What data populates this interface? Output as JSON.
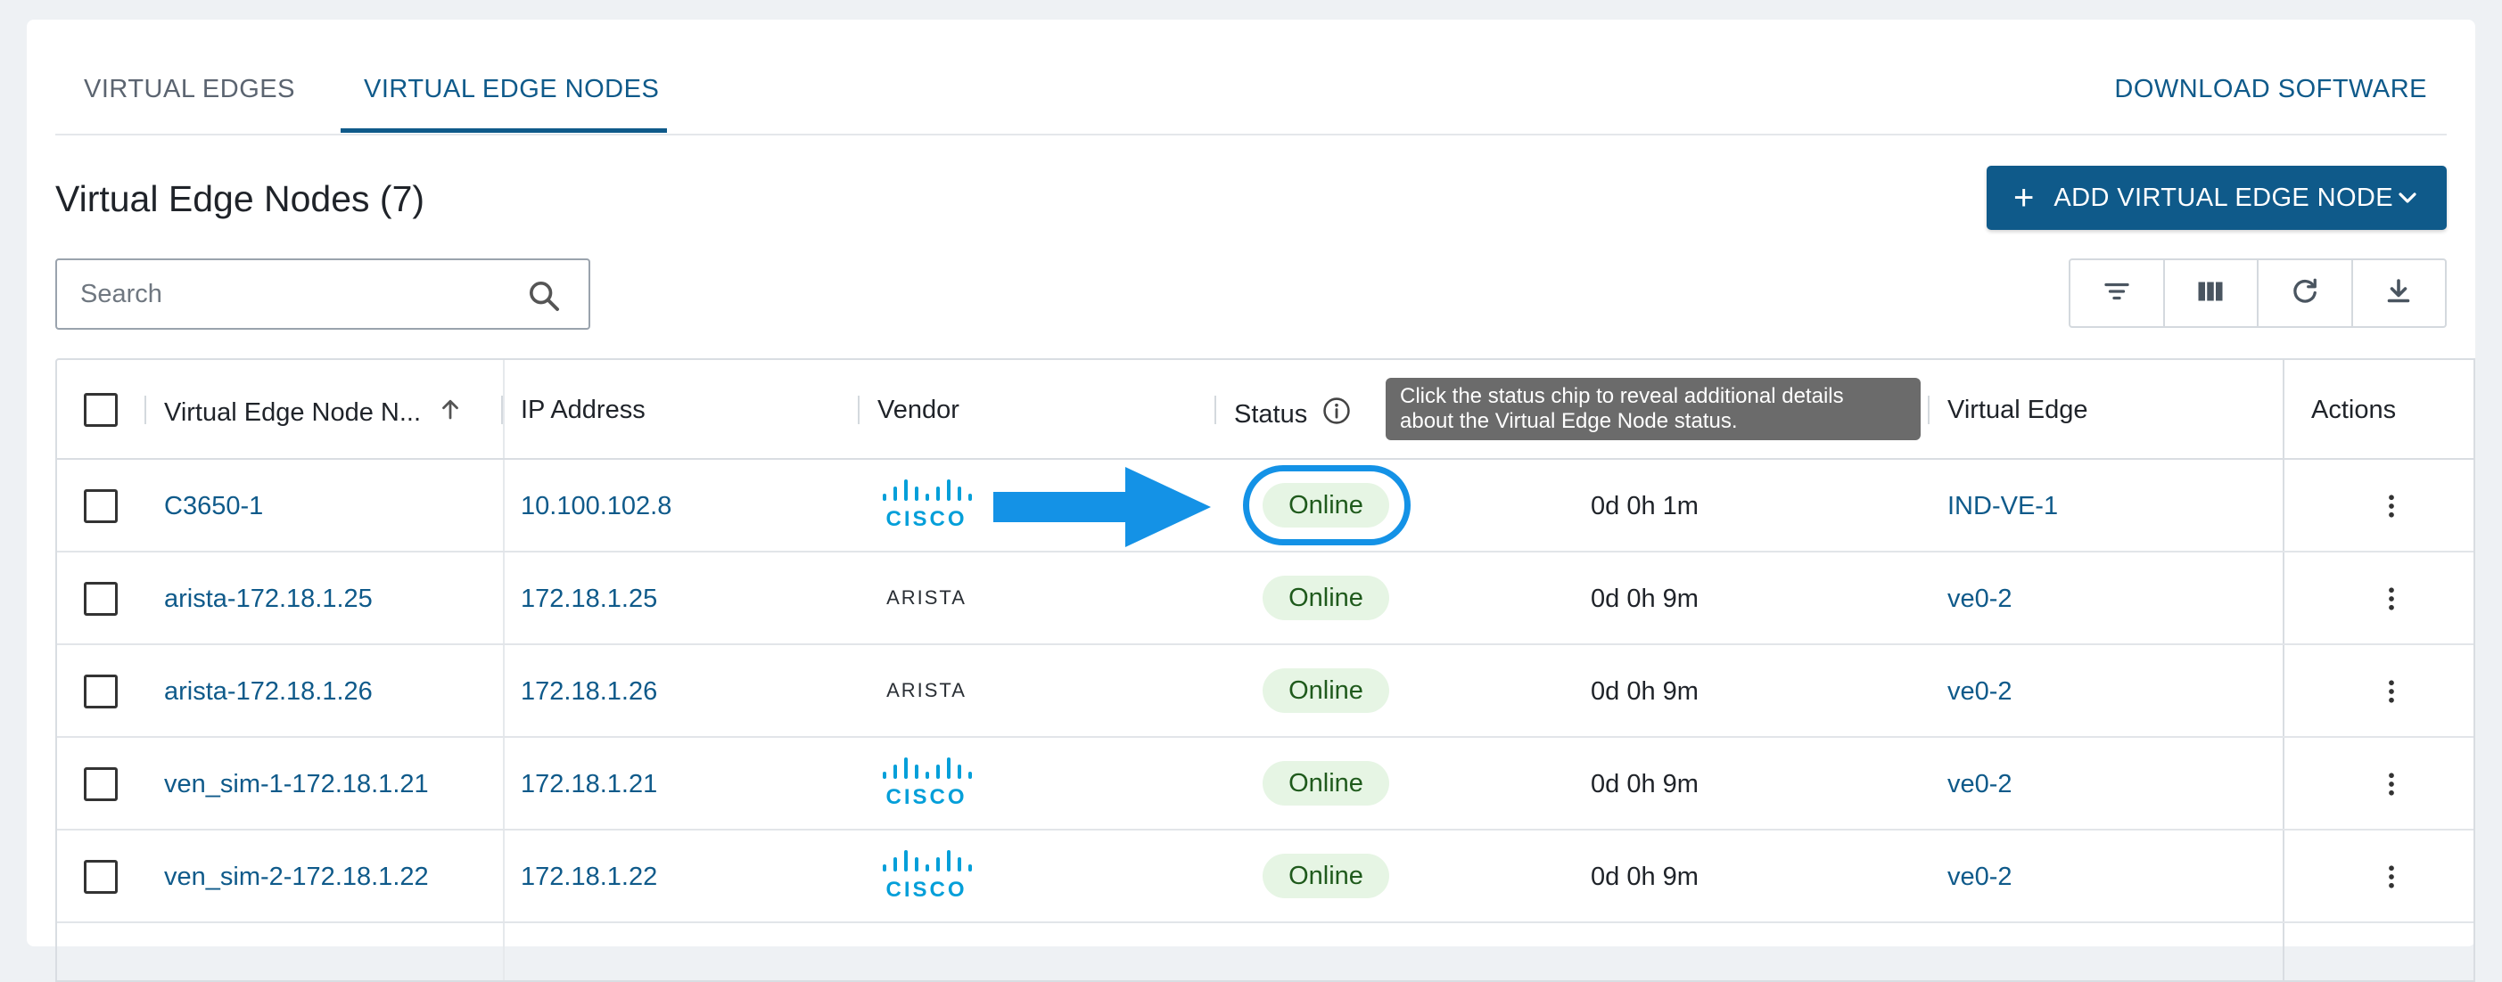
{
  "tabs": {
    "virtual_edges": "VIRTUAL EDGES",
    "virtual_edge_nodes": "VIRTUAL EDGE NODES",
    "download": "DOWNLOAD SOFTWARE"
  },
  "header": {
    "title": "Virtual Edge Nodes (7)",
    "add_button": "ADD VIRTUAL EDGE NODE"
  },
  "search": {
    "placeholder": "Search"
  },
  "toolbar": {
    "icons": [
      "filter-icon",
      "columns-icon",
      "refresh-icon",
      "download-icon"
    ]
  },
  "table": {
    "columns": {
      "name": "Virtual Edge Node N...",
      "ip": "IP Address",
      "vendor": "Vendor",
      "status": "Status",
      "virtual_edge": "Virtual Edge",
      "actions": "Actions"
    },
    "rows": [
      {
        "name": "C3650-1",
        "ip": "10.100.102.8",
        "vendor": "CISCO",
        "status": "Online",
        "uptime": "0d 0h 1m",
        "virtual_edge": "IND-VE-1"
      },
      {
        "name": "arista-172.18.1.25",
        "ip": "172.18.1.25",
        "vendor": "ARISTA",
        "status": "Online",
        "uptime": "0d 0h 9m",
        "virtual_edge": "ve0-2"
      },
      {
        "name": "arista-172.18.1.26",
        "ip": "172.18.1.26",
        "vendor": "ARISTA",
        "status": "Online",
        "uptime": "0d 0h 9m",
        "virtual_edge": "ve0-2"
      },
      {
        "name": "ven_sim-1-172.18.1.21",
        "ip": "172.18.1.21",
        "vendor": "CISCO",
        "status": "Online",
        "uptime": "0d 0h 9m",
        "virtual_edge": "ve0-2"
      },
      {
        "name": "ven_sim-2-172.18.1.22",
        "ip": "172.18.1.22",
        "vendor": "CISCO",
        "status": "Online",
        "uptime": "0d 0h 9m",
        "virtual_edge": "ve0-2"
      }
    ]
  },
  "tooltip": {
    "line1": "Click the status chip to reveal additional details",
    "line2": "about the Virtual Edge Node status."
  },
  "colors": {
    "primary": "#0f5a8a",
    "chip_bg": "#e6f5e4",
    "chip_text": "#1f5a1c",
    "highlight": "#1492e6",
    "cisco": "#049fd9"
  }
}
